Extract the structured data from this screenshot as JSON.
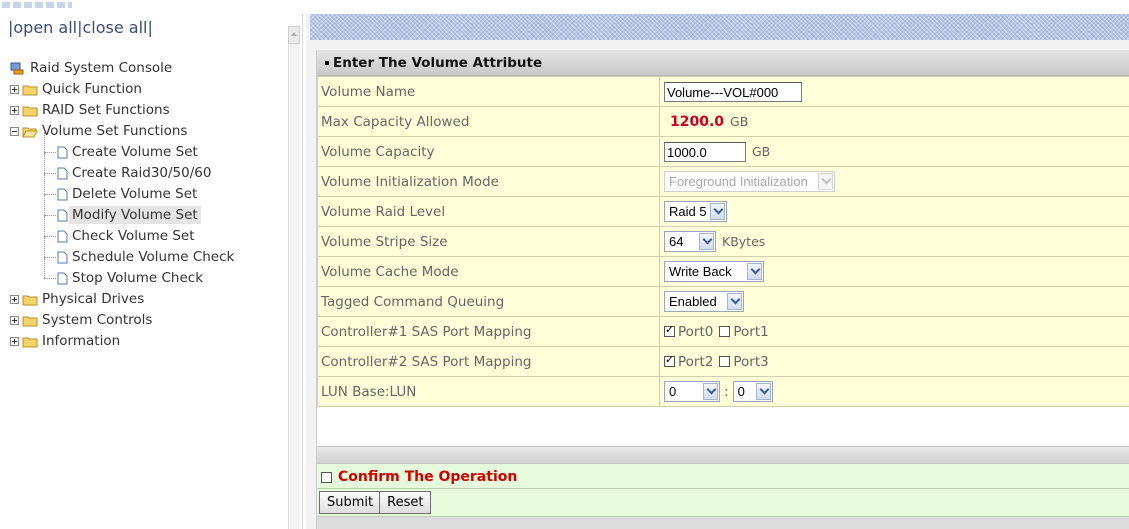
{
  "nav": {
    "open_all": "open all",
    "close_all": "close all",
    "root": "Raid System Console",
    "items": [
      {
        "label": "Quick Function"
      },
      {
        "label": "RAID Set Functions"
      },
      {
        "label": "Volume Set Functions"
      },
      {
        "label": "Physical Drives"
      },
      {
        "label": "System Controls"
      },
      {
        "label": "Information"
      }
    ],
    "volume_children": [
      {
        "label": "Create Volume Set"
      },
      {
        "label": "Create Raid30/50/60"
      },
      {
        "label": "Delete Volume Set"
      },
      {
        "label": "Modify Volume Set"
      },
      {
        "label": "Check Volume Set"
      },
      {
        "label": "Schedule Volume Check"
      },
      {
        "label": "Stop Volume Check"
      }
    ],
    "selected": "Modify Volume Set"
  },
  "form": {
    "header": "Enter The Volume Attribute",
    "fields": {
      "volume_name": {
        "label": "Volume Name",
        "value": "Volume---VOL#000"
      },
      "max_capacity": {
        "label": "Max Capacity Allowed",
        "value": "1200.0",
        "unit": "GB"
      },
      "volume_capacity": {
        "label": "Volume Capacity",
        "value": "1000.0",
        "unit": "GB"
      },
      "init_mode": {
        "label": "Volume Initialization Mode",
        "value": "Foreground Initialization",
        "disabled": true
      },
      "raid_level": {
        "label": "Volume Raid Level",
        "value": "Raid 5"
      },
      "stripe_size": {
        "label": "Volume Stripe Size",
        "value": "64",
        "unit": "KBytes"
      },
      "cache_mode": {
        "label": "Volume Cache Mode",
        "value": "Write Back"
      },
      "tcq": {
        "label": "Tagged Command Queuing",
        "value": "Enabled"
      },
      "ctrl1_mapping": {
        "label": "Controller#1 SAS Port Mapping",
        "port_a": "Port0",
        "port_a_checked": true,
        "port_b": "Port1",
        "port_b_checked": false
      },
      "ctrl2_mapping": {
        "label": "Controller#2 SAS Port Mapping",
        "port_a": "Port2",
        "port_a_checked": true,
        "port_b": "Port3",
        "port_b_checked": false
      },
      "lun": {
        "label": "LUN Base:LUN",
        "base": "0",
        "separator": ":",
        "lun": "0"
      }
    },
    "confirm_label": "Confirm The Operation",
    "confirm_checked": false,
    "submit_label": "Submit",
    "reset_label": "Reset"
  },
  "colors": {
    "capacity_value": "#cc0022",
    "confirm_text": "#d00000",
    "row_bg": "#fefed8",
    "confirm_bg": "#e6fadc"
  }
}
